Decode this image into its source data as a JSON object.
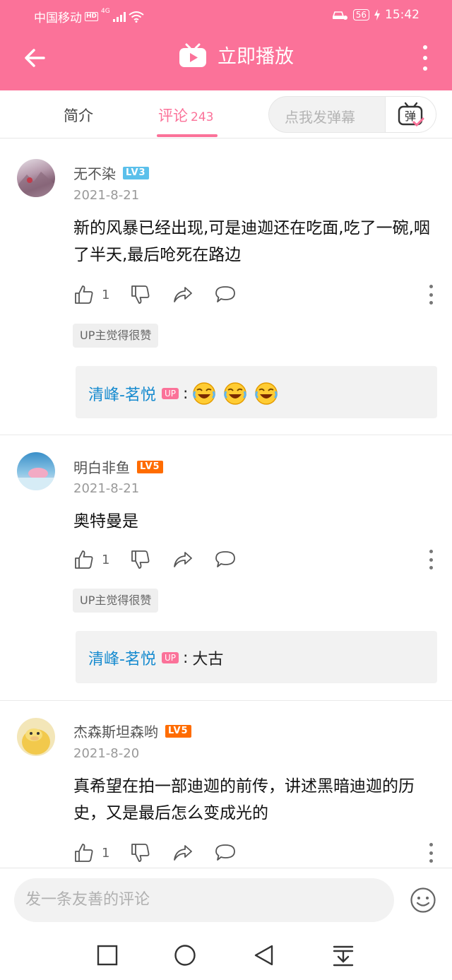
{
  "status_bar": {
    "carrier": "中国移动",
    "hd": "HD",
    "network": "4G",
    "battery": "56",
    "time": "15:42"
  },
  "header": {
    "title": "立即播放"
  },
  "tabs": {
    "intro": "简介",
    "comments_label": "评论",
    "comments_count": "243",
    "danmaku_placeholder": "点我发弹幕",
    "danmaku_button": "弹"
  },
  "comments": [
    {
      "user": "无不染",
      "level": "LV3",
      "level_color": "#5bc0eb",
      "date": "2021-8-21",
      "text": "新的风暴已经出现,可是迪迦还在吃面,吃了一碗,咽了半天,最后呛死在路边",
      "likes": "1",
      "praise": "UP主觉得很赞",
      "reply": {
        "user": "清峰-茗悦",
        "badge": "UP",
        "text": "",
        "emojis": [
          "laugh-cry-emoji",
          "laugh-cry-emoji",
          "laugh-cry-emoji"
        ]
      }
    },
    {
      "user": "明白非鱼",
      "level": "LV5",
      "level_color": "#ff6c00",
      "date": "2021-8-21",
      "text": "奥特曼是",
      "likes": "1",
      "praise": "UP主觉得很赞",
      "reply": {
        "user": "清峰-茗悦",
        "badge": "UP",
        "text": "大古"
      }
    },
    {
      "user": "杰森斯坦森哟",
      "level": "LV5",
      "level_color": "#ff6c00",
      "date": "2021-8-20",
      "text": "真希望在拍一部迪迦的前传，讲述黑暗迪迦的历史，又是最后怎么变成光的",
      "likes": "1"
    }
  ],
  "input": {
    "placeholder": "发一条友善的评论"
  },
  "colors": {
    "accent": "#fb7299",
    "reply_name": "#178bcf"
  }
}
